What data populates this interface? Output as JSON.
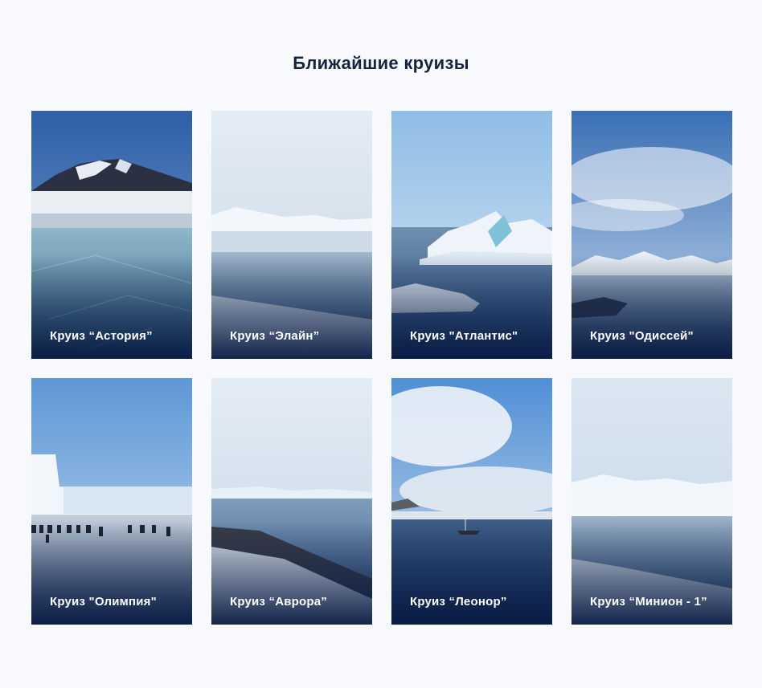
{
  "section": {
    "title": "Ближайшие круизы"
  },
  "cruises": [
    {
      "label": "Круиз “Астория”",
      "scene": "frozen-lake-mountain"
    },
    {
      "label": "Круиз “Элайн”",
      "scene": "calm-bay-glaciers"
    },
    {
      "label": "Круиз \"Атлантис\"",
      "scene": "iceberg-sea"
    },
    {
      "label": "Круиз \"Одиссей\"",
      "scene": "cloudy-sky-mountains"
    },
    {
      "label": "Круиз \"Олимпия\"",
      "scene": "penguins-ice-shelf"
    },
    {
      "label": "Круиз “Аврора”",
      "scene": "penguin-colony-shore"
    },
    {
      "label": "Круиз “Леонор”",
      "scene": "sailboat-bay"
    },
    {
      "label": "Круиз “Минион - 1”",
      "scene": "snowy-coast"
    }
  ]
}
